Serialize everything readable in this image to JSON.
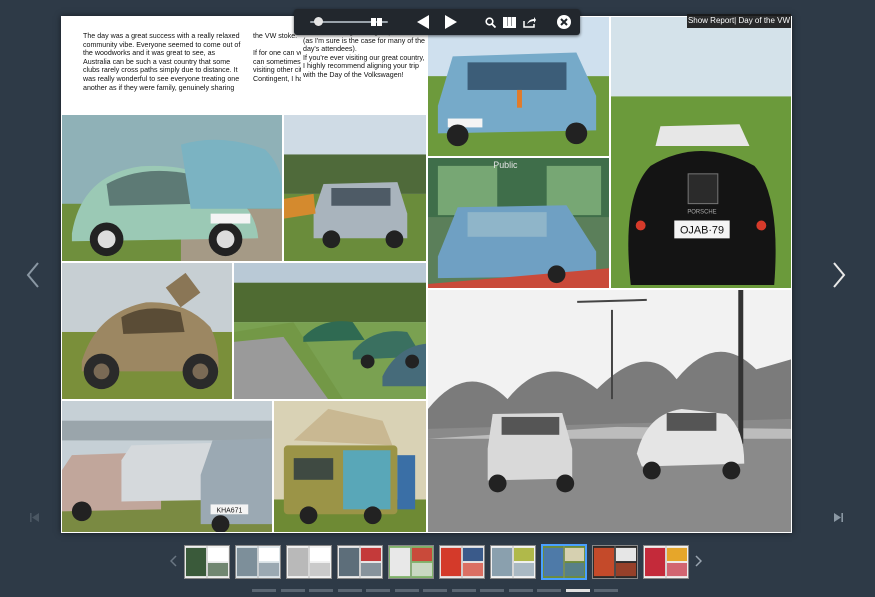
{
  "toolbar": {
    "zoom_level": 0.05,
    "icons": [
      "zoom-slider",
      "single-page-icon",
      "previous-page-icon",
      "next-page-icon",
      "search-icon",
      "thumbnails-icon",
      "share-icon",
      "close-icon"
    ]
  },
  "report_link": "Show Report| Day of the VW",
  "article": {
    "text": "The day was a great success with a really relaxed community vibe. Everyone seemed to come out of the woodworks and it was great to see, as Australia can be such a vast country that some clubs rarely cross paths simply due to distance. It was really wonderful to see everyone treating one another as if they were family, genuinely sharing the VW stoke.\n\nIf for one can vouch for this, as a Sydney-sider, it can sometimes put you on the outside a little when visiting other cities, but thanks to the Type 3 Contingent, I have never felt so at home, and",
    "text_right": "I've made a huge new group of friends (as I'm sure is the case for many of the day's attendees).\nIf you're ever visiting our great country, I highly recommend aligning your trip with the Day of the Volkswagen!"
  },
  "photos": {
    "plate_left": "KHA671",
    "plate_right": "OJAB·79",
    "plate_sub": "PORSCHE",
    "sign_public": "Public"
  },
  "nav": {
    "prev_icon": "chevron-left-icon",
    "next_icon": "chevron-right-icon",
    "first_icon": "first-page-icon",
    "last_icon": "last-page-icon"
  },
  "thumbnails": {
    "count": 10,
    "active_index": 7
  },
  "pagination": {
    "count": 13,
    "active_index": 11
  },
  "colors": {
    "background": "#2e3a47",
    "toolbar": "#22272d",
    "active_thumb": "#4aa0ff"
  }
}
